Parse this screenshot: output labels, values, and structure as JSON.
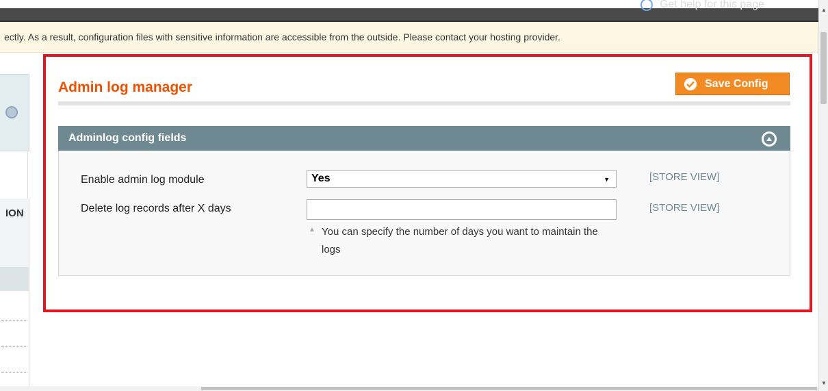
{
  "header": {
    "help_link": "Get help for this page"
  },
  "notice": {
    "message": "ectly. As a result, configuration files with sensitive information are accessible from the outside. Please contact your hosting provider."
  },
  "sidebar": {
    "column_fragment": "ION"
  },
  "page": {
    "title": "Admin log manager",
    "save_button_label": "Save Config"
  },
  "section": {
    "title": "Adminlog config fields",
    "fields": [
      {
        "label": "Enable admin log module",
        "value": "Yes",
        "scope": "[STORE VIEW]"
      },
      {
        "label": "Delete log records after X days",
        "value": "",
        "scope": "[STORE VIEW]",
        "hint": "You can specify the number of days you want to maintain the logs"
      }
    ]
  },
  "colors": {
    "title_orange": "#eb5202",
    "button_orange": "#f38b25",
    "section_header": "#6f8992",
    "highlight_frame": "#e3161d",
    "notice_bg": "#fdf6e3"
  },
  "icons": {
    "help": "help-circle-icon",
    "save": "check-circle-icon",
    "collapse": "collapse-up-icon"
  }
}
